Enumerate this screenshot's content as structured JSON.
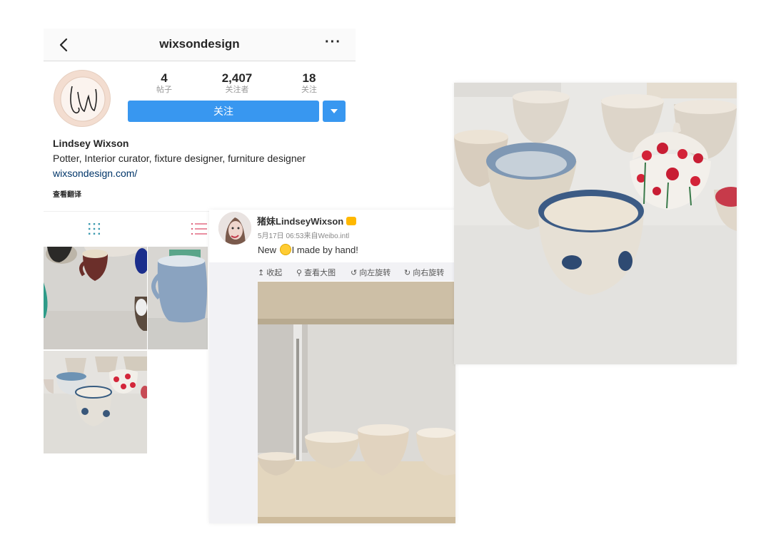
{
  "instagram": {
    "title": "wixsondesign",
    "more_label": "···",
    "stats": [
      {
        "value": "4",
        "label": "帖子"
      },
      {
        "value": "2,407",
        "label": "关注者"
      },
      {
        "value": "18",
        "label": "关注"
      }
    ],
    "follow_label": "关注",
    "name": "Lindsey Wixson",
    "bio": "Potter, Interior curator, fixture designer, furniture designer",
    "link": "wixsondesign.com/",
    "translate_label": "查看翻译",
    "accent_color": "#3897f0",
    "icons": [
      "back-arrow-icon",
      "more-icon",
      "chevron-down-icon",
      "grid-icon",
      "list-icon"
    ]
  },
  "weibo": {
    "name": "猪妹LindseyWixson",
    "meta": "5月17日 06:53来自Weibo.intl",
    "text_before": "New ",
    "text_after": "I made by hand!",
    "actions": [
      {
        "icon": "↥",
        "label": "收起"
      },
      {
        "icon": "⚲",
        "label": "查看大图"
      },
      {
        "icon": "↺",
        "label": "向左旋转"
      },
      {
        "icon": "↻",
        "label": "向右旋转"
      }
    ]
  }
}
